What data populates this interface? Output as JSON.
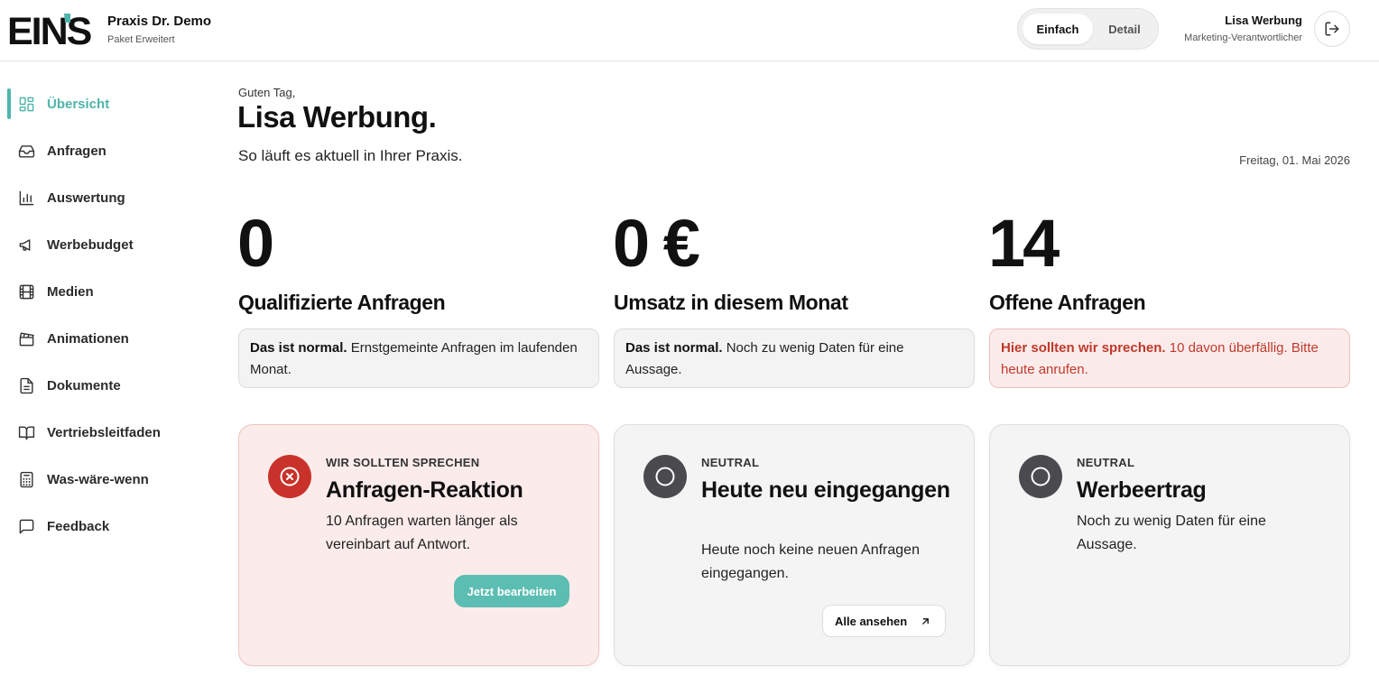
{
  "header": {
    "logo_text": "EINS",
    "practice_name": "Praxis Dr. Demo",
    "package": "Paket Erweitert",
    "modes": [
      "Einfach",
      "Detail"
    ],
    "active_mode": "Einfach",
    "user": {
      "name": "Lisa Werbung",
      "role": "Marketing-Verantwortlicher"
    },
    "logout_icon": "logout-icon"
  },
  "sidebar": {
    "items": [
      {
        "label": "Übersicht",
        "icon": "grid-icon",
        "active": true
      },
      {
        "label": "Anfragen",
        "icon": "inbox-icon"
      },
      {
        "label": "Auswertung",
        "icon": "bar-chart-icon"
      },
      {
        "label": "Werbebudget",
        "icon": "megaphone-icon"
      },
      {
        "label": "Medien",
        "icon": "film-icon"
      },
      {
        "label": "Animationen",
        "icon": "clapperboard-icon"
      },
      {
        "label": "Dokumente",
        "icon": "document-icon"
      },
      {
        "label": "Vertriebsleitfaden",
        "icon": "book-icon"
      },
      {
        "label": "Was-wäre-wenn",
        "icon": "calculator-icon"
      },
      {
        "label": "Feedback",
        "icon": "message-icon"
      }
    ]
  },
  "greeting": {
    "salutation": "Guten Tag,",
    "name": "Lisa Werbung.",
    "subtitle": "So läuft es aktuell in Ihrer Praxis.",
    "date": "Freitag, 01. Mai 2026"
  },
  "kpis": [
    {
      "value": "0",
      "label": "Qualifizierte Anfragen",
      "note_bold": "Das ist normal.",
      "note_text": " Ernstgemeinte Anfragen im laufenden Monat."
    },
    {
      "value": "0 €",
      "label": "Umsatz in diesem Monat",
      "note_bold": "Das ist normal.",
      "note_text": " Noch zu wenig Daten für eine Aussage."
    },
    {
      "value": "14",
      "label": "Offene Anfragen",
      "note_bold": "Hier sollten wir sprechen.",
      "note_text": " 10 davon überfällig. Bitte heute anrufen."
    }
  ],
  "cards": [
    {
      "kicker": "WIR SOLLTEN SPRECHEN",
      "title": "Anfragen-Reaktion",
      "description": "10 Anfragen warten länger als vereinbart auf Antwort.",
      "action": "Jetzt bearbeiten",
      "status_icon": "x-circle-icon"
    },
    {
      "kicker": "NEUTRAL",
      "title": "Heute neu eingegangen",
      "description": "Heute noch keine neuen Anfragen eingegangen.",
      "action": "Alle ansehen",
      "status_icon": "circle-icon",
      "action_icon": "arrow-up-right-icon"
    },
    {
      "kicker": "NEUTRAL",
      "title": "Werbeertrag",
      "description": "Noch zu wenig Daten für eine Aussage.",
      "status_icon": "circle-icon"
    }
  ],
  "colors": {
    "accent": "#4fb5ab",
    "button": "#5cbdb2",
    "alert": "#c0392b",
    "alert_bg": "#fbeceb",
    "neutral_badge": "#4a4a4f"
  }
}
